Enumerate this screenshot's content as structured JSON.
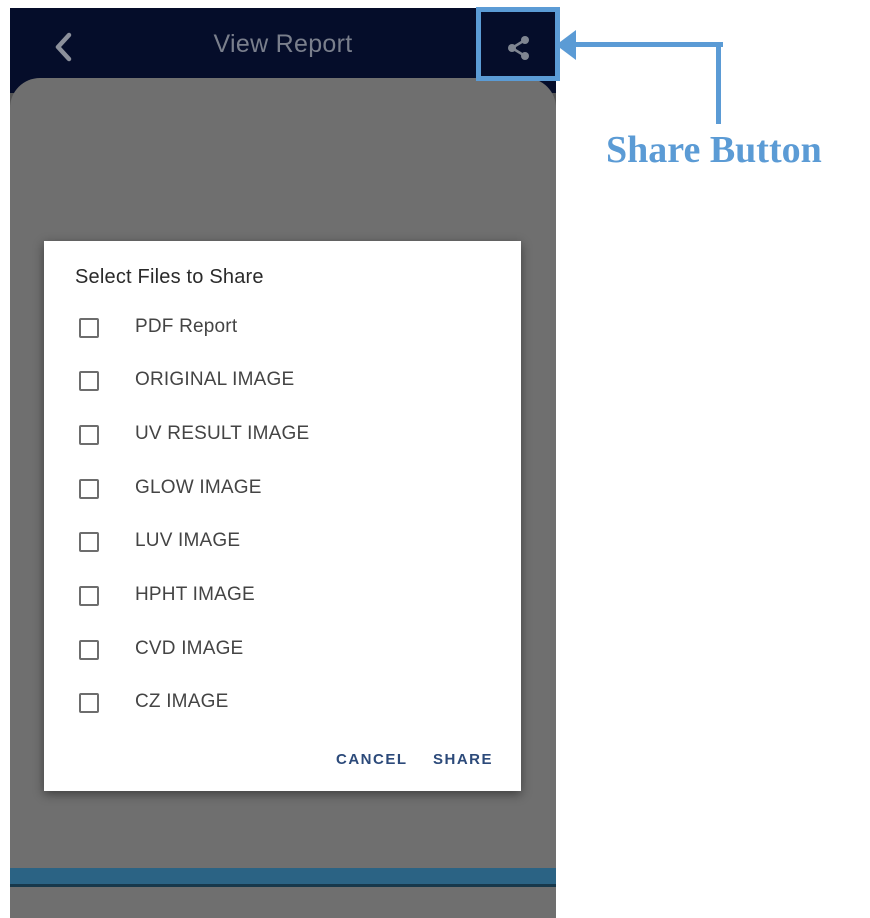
{
  "app_bar": {
    "title": "View Report",
    "back_icon": "chevron-left-icon",
    "share_icon": "share-icon"
  },
  "dialog": {
    "title": "Select Files to Share",
    "options": [
      {
        "label": "PDF Report",
        "checked": false
      },
      {
        "label": "ORIGINAL IMAGE",
        "checked": false
      },
      {
        "label": "UV RESULT IMAGE",
        "checked": false
      },
      {
        "label": "GLOW IMAGE",
        "checked": false
      },
      {
        "label": "LUV IMAGE",
        "checked": false
      },
      {
        "label": "HPHT IMAGE",
        "checked": false
      },
      {
        "label": "CVD IMAGE",
        "checked": false
      },
      {
        "label": "CZ IMAGE",
        "checked": false
      }
    ],
    "cancel_label": "CANCEL",
    "share_label": "SHARE"
  },
  "annotation": {
    "label": "Share Button",
    "color": "#5b9bd5"
  },
  "colors": {
    "app_bar_bg": "#050d2a",
    "scrim": "#6f6f6f",
    "button_text": "#2c4a7a"
  }
}
